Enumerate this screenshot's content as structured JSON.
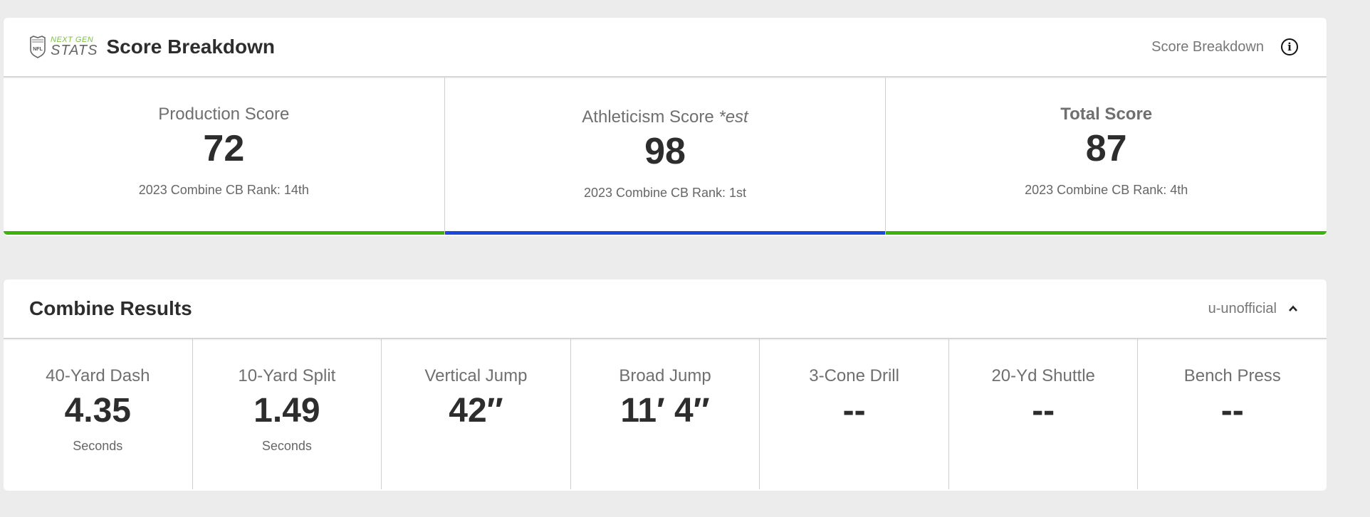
{
  "score_breakdown": {
    "logo": {
      "top": "NEXT GEN",
      "bottom": "STATS",
      "icon": "nfl-shield-icon"
    },
    "title": "Score Breakdown",
    "right_label": "Score Breakdown",
    "info_icon": "info-icon",
    "scores": [
      {
        "label": "Production Score",
        "suffix": "",
        "value": "72",
        "rank": "2023 Combine CB Rank: 14th",
        "bar_color": "#3cb30b",
        "bold_label": false
      },
      {
        "label": "Athleticism Score ",
        "suffix": "*est",
        "value": "98",
        "rank": "2023 Combine CB Rank: 1st",
        "bar_color": "#1b48db",
        "bold_label": false
      },
      {
        "label": "Total Score",
        "suffix": "",
        "value": "87",
        "rank": "2023 Combine CB Rank: 4th",
        "bar_color": "#3cb30b",
        "bold_label": true
      }
    ]
  },
  "combine_results": {
    "title": "Combine Results",
    "right_label": "u-unofficial",
    "toggle_icon": "chevron-up-icon",
    "items": [
      {
        "label": "40-Yard Dash",
        "value": "4.35",
        "unit": "Seconds"
      },
      {
        "label": "10-Yard Split",
        "value": "1.49",
        "unit": "Seconds"
      },
      {
        "label": "Vertical Jump",
        "value": "42″",
        "unit": ""
      },
      {
        "label": "Broad Jump",
        "value": "11′ 4″",
        "unit": ""
      },
      {
        "label": "3-Cone Drill",
        "value": "--",
        "unit": ""
      },
      {
        "label": "20-Yd Shuttle",
        "value": "--",
        "unit": ""
      },
      {
        "label": "Bench Press",
        "value": "--",
        "unit": ""
      }
    ]
  }
}
